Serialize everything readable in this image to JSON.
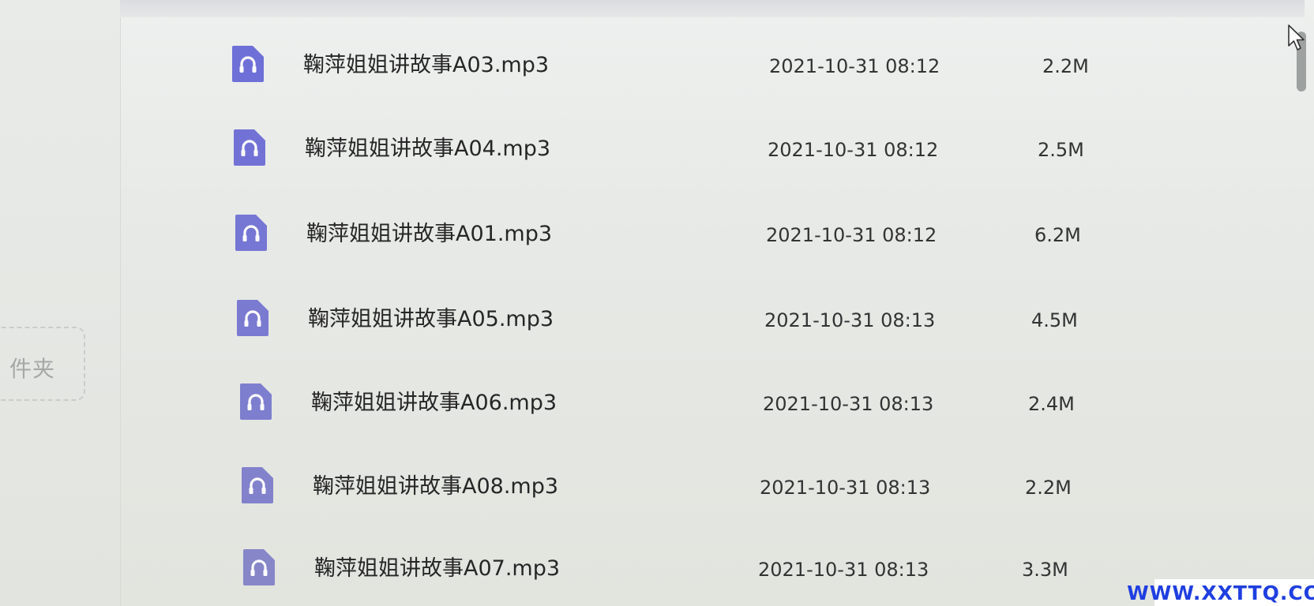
{
  "sidebar": {
    "new_folder_label": "件夹"
  },
  "file_icon": "headphones-audio-file-icon",
  "files": [
    {
      "name": "鞠萍姐姐讲故事A03.mp3",
      "date": "2021-10-31 08:12",
      "size": "2.2M"
    },
    {
      "name": "鞠萍姐姐讲故事A04.mp3",
      "date": "2021-10-31 08:12",
      "size": "2.5M"
    },
    {
      "name": "鞠萍姐姐讲故事A01.mp3",
      "date": "2021-10-31 08:12",
      "size": "6.2M"
    },
    {
      "name": "鞠萍姐姐讲故事A05.mp3",
      "date": "2021-10-31 08:13",
      "size": "4.5M"
    },
    {
      "name": "鞠萍姐姐讲故事A06.mp3",
      "date": "2021-10-31 08:13",
      "size": "2.4M"
    },
    {
      "name": "鞠萍姐姐讲故事A08.mp3",
      "date": "2021-10-31 08:13",
      "size": "2.2M"
    },
    {
      "name": "鞠萍姐姐讲故事A07.mp3",
      "date": "2021-10-31 08:13",
      "size": "3.3M"
    }
  ],
  "watermark": "WWW.XXTTQ.COM",
  "colors": {
    "icon": "#6f6fd8",
    "watermark": "#1f3fe0"
  }
}
